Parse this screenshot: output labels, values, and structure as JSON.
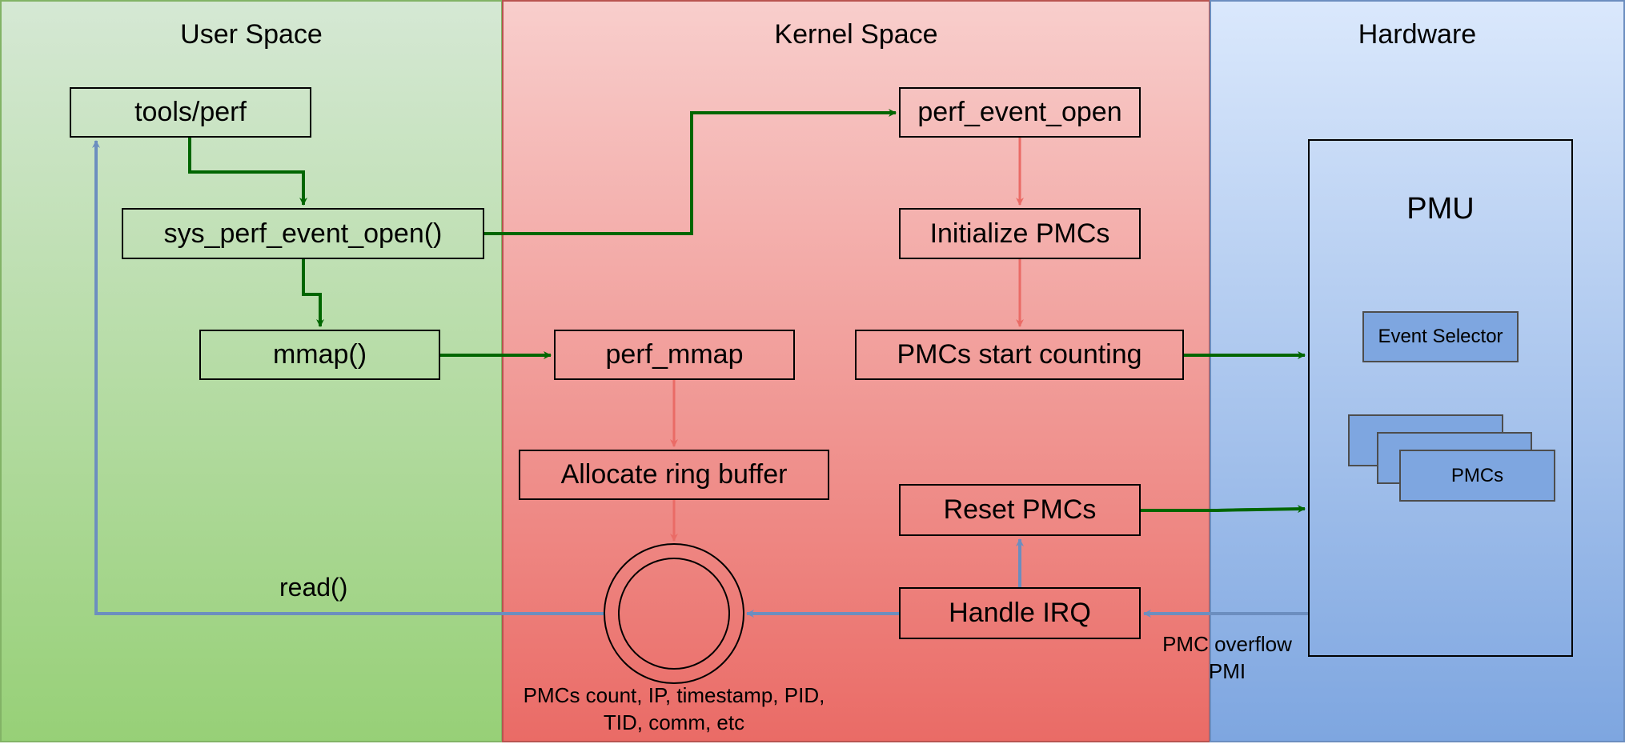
{
  "lanes": {
    "user": {
      "title": "User Space"
    },
    "kernel": {
      "title": "Kernel Space"
    },
    "hardware": {
      "title": "Hardware"
    }
  },
  "user_nodes": {
    "tools_perf": "tools/perf",
    "sys_perf_event_open": "sys_perf_event_open()",
    "mmap": "mmap()",
    "read_label": "read()"
  },
  "kernel_nodes": {
    "perf_event_open": "perf_event_open",
    "initialize_pmcs": "Initialize PMCs",
    "pmcs_start_counting": "PMCs start counting",
    "perf_mmap": "perf_mmap",
    "allocate_ring_buffer": "Allocate ring buffer",
    "reset_pmcs": "Reset PMCs",
    "handle_irq": "Handle IRQ",
    "ring_buffer_caption_line1": "PMCs count, IP, timestamp, PID,",
    "ring_buffer_caption_line2": "TID, comm, etc"
  },
  "hardware_nodes": {
    "pmu": "PMU",
    "event_selector": "Event Selector",
    "pmcs": "PMCs",
    "overflow_label_line1": "PMC overflow",
    "overflow_label_line2": "PMI"
  },
  "colors": {
    "green_arrow": "#006600",
    "red_arrow": "#ea6b66",
    "blue_arrow": "#6c8ebf",
    "user_fill_top": "#d5e8d4",
    "user_fill_bottom": "#97d077",
    "kernel_fill_top": "#f8cecc",
    "kernel_fill_bottom": "#ea6b66",
    "hw_fill_top": "#dae8fc",
    "hw_fill_bottom": "#7ea6e0"
  }
}
